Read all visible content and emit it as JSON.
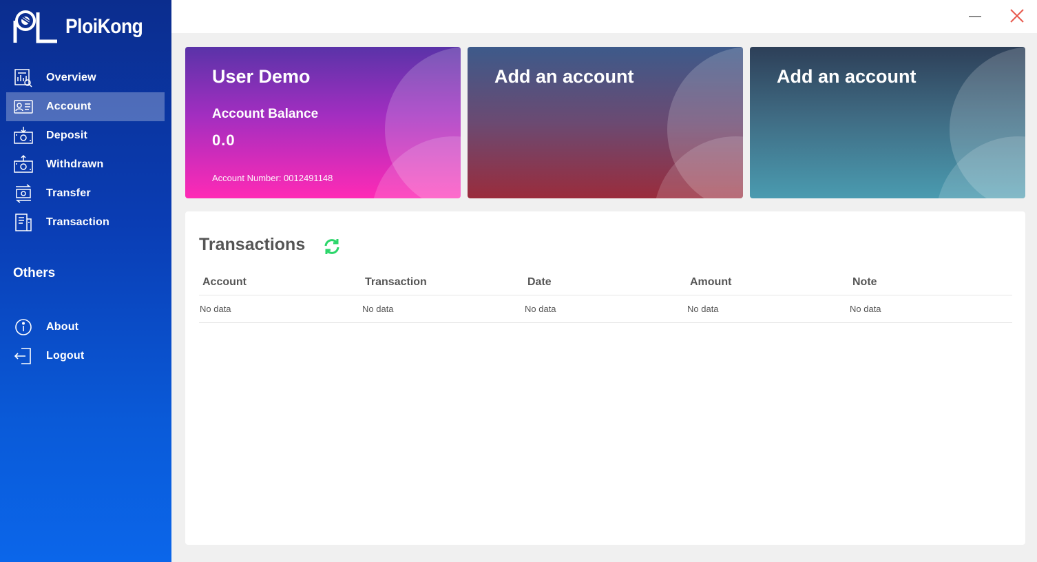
{
  "app": {
    "name": "PloiKong"
  },
  "sidebar": {
    "items": [
      {
        "label": "Overview",
        "icon": "overview-icon"
      },
      {
        "label": "Account",
        "icon": "account-card-icon",
        "active": true
      },
      {
        "label": "Deposit",
        "icon": "deposit-icon"
      },
      {
        "label": "Withdrawn",
        "icon": "withdraw-icon"
      },
      {
        "label": "Transfer",
        "icon": "transfer-icon"
      },
      {
        "label": "Transaction",
        "icon": "transaction-icon"
      }
    ],
    "others_title": "Others",
    "others": [
      {
        "label": "About",
        "icon": "info-icon"
      },
      {
        "label": "Logout",
        "icon": "logout-icon"
      }
    ]
  },
  "cards": [
    {
      "title": "User Demo",
      "balance_label": "Account Balance",
      "balance": "0.0",
      "account_number": "Account Number: 0012491148"
    },
    {
      "title": "Add an account"
    },
    {
      "title": "Add an account"
    }
  ],
  "transactions": {
    "title": "Transactions",
    "columns": [
      "Account",
      "Transaction",
      "Date",
      "Amount",
      "Note"
    ],
    "rows": [
      [
        "No data",
        "No data",
        "No data",
        "No data",
        "No data"
      ]
    ]
  },
  "colors": {
    "accent_green": "#2bd66a",
    "close_red": "#e8584c",
    "sidebar_top": "#0b2d8e",
    "sidebar_bottom": "#0b66ea"
  }
}
